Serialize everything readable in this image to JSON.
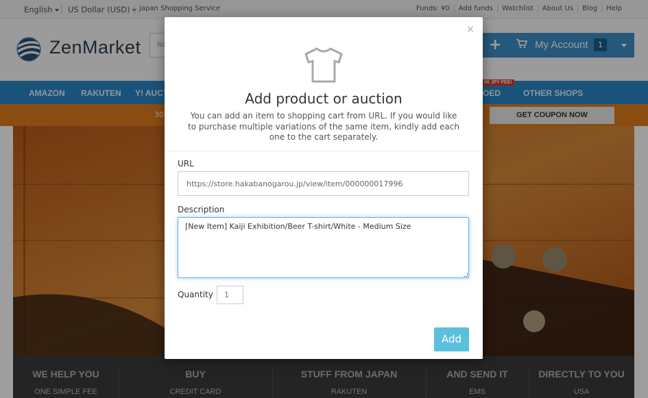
{
  "topbar": {
    "language": "English",
    "currency": "US Dollar (USD)",
    "service": "Japan Shopping Service",
    "links": [
      "Funds: ¥0",
      "Add funds",
      "Watchlist",
      "About Us",
      "Blog",
      "Help"
    ]
  },
  "header": {
    "logo_text": "ZenMarket",
    "search_placeholder_fragment": "Ra",
    "account_label": "My Account",
    "cart_count": "1"
  },
  "nav": {
    "items": [
      "AMAZON",
      "RAKUTEN",
      "Y! AUCT",
      "OED",
      "OTHER SHOPS"
    ],
    "ribbon": "00 JPY FEE!"
  },
  "promo": {
    "text": "30",
    "button": "GET COUPON NOW"
  },
  "footer": {
    "columns": [
      {
        "heading": "WE HELP YOU",
        "sub": "ONE SIMPLE FEE"
      },
      {
        "heading": "BUY",
        "sub": "CREDIT CARD"
      },
      {
        "heading": "STUFF FROM JAPAN",
        "sub": "RAKUTEN"
      },
      {
        "heading": "AND SEND IT",
        "sub": "EMS"
      },
      {
        "heading": "DIRECTLY TO YOU",
        "sub": "USA"
      }
    ]
  },
  "modal": {
    "close_glyph": "×",
    "icon": "t-shirt-icon",
    "title": "Add product or auction",
    "intro": "You can add an item to shopping cart from URL. If you would like to purchase multiple variations of the same item, kindly add each one to the cart separately.",
    "url_label": "URL",
    "url_value": "https://store.hakabanogarou.jp/view/item/000000017996",
    "description_label": "Description",
    "description_value": "[New Item] Kaiji Exhibition/Beer T-shirt/White - Medium Size",
    "quantity_label": "Quantity",
    "quantity_placeholder": "1",
    "add_button": "Add"
  },
  "colors": {
    "nav_blue": "#2a87c6",
    "account_blue": "#3d8fc6",
    "promo_orange": "#e07b1c",
    "add_button": "#5bc0de",
    "footer_bg": "#3a3b3c"
  }
}
